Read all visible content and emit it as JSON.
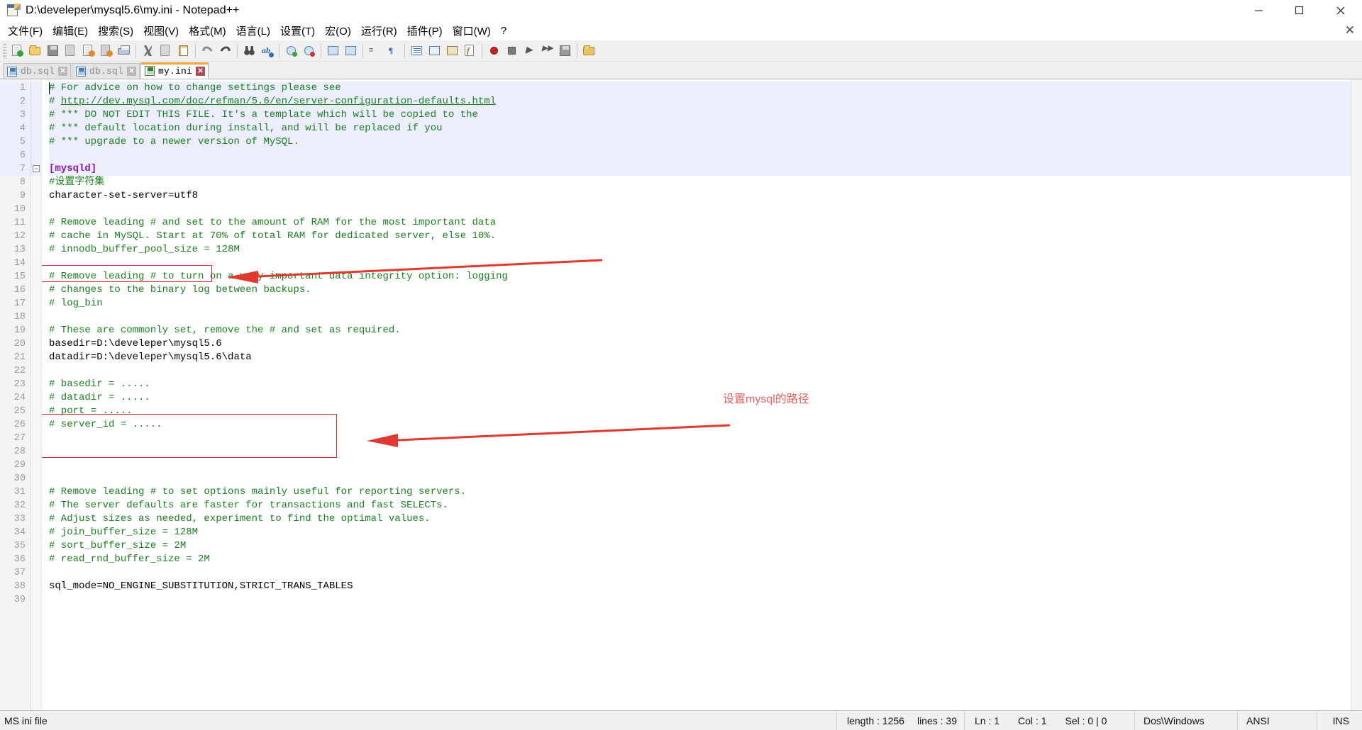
{
  "window": {
    "title": "D:\\develeper\\mysql5.6\\my.ini - Notepad++",
    "icon": "notepad-plus-plus-icon",
    "minimize_label": "–",
    "maximize_label": "❐",
    "close_label": "✕"
  },
  "menu": {
    "items": [
      {
        "label": "文件(F)",
        "name": "menu-file"
      },
      {
        "label": "编辑(E)",
        "name": "menu-edit"
      },
      {
        "label": "搜索(S)",
        "name": "menu-search"
      },
      {
        "label": "视图(V)",
        "name": "menu-view"
      },
      {
        "label": "格式(M)",
        "name": "menu-format"
      },
      {
        "label": "语言(L)",
        "name": "menu-language"
      },
      {
        "label": "设置(T)",
        "name": "menu-settings"
      },
      {
        "label": "宏(O)",
        "name": "menu-macro"
      },
      {
        "label": "运行(R)",
        "name": "menu-run"
      },
      {
        "label": "插件(P)",
        "name": "menu-plugins"
      },
      {
        "label": "窗口(W)",
        "name": "menu-window"
      },
      {
        "label": "?",
        "name": "menu-help"
      }
    ],
    "close_doc_label": "✕"
  },
  "toolbar": {
    "buttons": [
      "new-file-icon",
      "open-file-icon",
      "save-icon",
      "save-all-icon",
      "close-file-icon",
      "close-all-icon",
      "print-icon",
      "cut-icon",
      "copy-icon",
      "paste-icon",
      "undo-icon",
      "redo-icon",
      "find-icon",
      "replace-icon",
      "zoom-in-icon",
      "zoom-out-icon",
      "sync-v-scroll-icon",
      "sync-h-scroll-icon",
      "word-wrap-icon",
      "show-all-chars-icon",
      "indent-guide-icon",
      "ui-ab-icon",
      "user-define-dialog-icon",
      "doc-map-icon",
      "record-macro-icon",
      "stop-macro-icon",
      "play-macro-icon",
      "fast-playback-icon",
      "save-macro-icon",
      "run-icon"
    ]
  },
  "tabs": [
    {
      "label": "db.sql",
      "active": false,
      "icon": "saved-file-icon",
      "close": "✕"
    },
    {
      "label": "db.sql",
      "active": false,
      "icon": "saved-file-icon",
      "close": "✕"
    },
    {
      "label": "my.ini",
      "active": true,
      "icon": "saved-file-icon",
      "close": "✕"
    }
  ],
  "editor": {
    "lines": [
      {
        "n": 1,
        "type": "comment",
        "text": "# For advice on how to change settings please see",
        "highlight": true
      },
      {
        "n": 2,
        "type": "link",
        "prefix": "# ",
        "text": "http://dev.mysql.com/doc/refman/5.6/en/server-configuration-defaults.html",
        "highlight": true
      },
      {
        "n": 3,
        "type": "comment",
        "text": "# *** DO NOT EDIT THIS FILE. It's a template which will be copied to the",
        "highlight": true
      },
      {
        "n": 4,
        "type": "comment",
        "text": "# *** default location during install, and will be replaced if you",
        "highlight": true
      },
      {
        "n": 5,
        "type": "comment",
        "text": "# *** upgrade to a newer version of MySQL.",
        "highlight": true
      },
      {
        "n": 6,
        "type": "blank",
        "text": "",
        "highlight": true
      },
      {
        "n": 7,
        "type": "section",
        "text": "[mysqld]",
        "highlight": true,
        "fold": true
      },
      {
        "n": 8,
        "type": "comment",
        "text": "#设置字符集",
        "highlight": false
      },
      {
        "n": 9,
        "type": "code",
        "text": "character-set-server=utf8",
        "highlight": false
      },
      {
        "n": 10,
        "type": "blank",
        "text": "",
        "highlight": false
      },
      {
        "n": 11,
        "type": "comment",
        "text": "# Remove leading # and set to the amount of RAM for the most important data",
        "highlight": false
      },
      {
        "n": 12,
        "type": "comment",
        "text": "# cache in MySQL. Start at 70% of total RAM for dedicated server, else 10%.",
        "highlight": false
      },
      {
        "n": 13,
        "type": "comment",
        "text": "# innodb_buffer_pool_size = 128M",
        "highlight": false
      },
      {
        "n": 14,
        "type": "blank",
        "text": "",
        "highlight": false
      },
      {
        "n": 15,
        "type": "comment",
        "text": "# Remove leading # to turn on a very important data integrity option: logging",
        "highlight": false
      },
      {
        "n": 16,
        "type": "comment",
        "text": "# changes to the binary log between backups.",
        "highlight": false
      },
      {
        "n": 17,
        "type": "comment",
        "text": "# log_bin",
        "highlight": false
      },
      {
        "n": 18,
        "type": "blank",
        "text": "",
        "highlight": false
      },
      {
        "n": 19,
        "type": "comment",
        "text": "# These are commonly set, remove the # and set as required.",
        "highlight": false
      },
      {
        "n": 20,
        "type": "code",
        "text": "basedir=D:\\develeper\\mysql5.6",
        "highlight": false
      },
      {
        "n": 21,
        "type": "code",
        "text": "datadir=D:\\develeper\\mysql5.6\\data",
        "highlight": false
      },
      {
        "n": 22,
        "type": "blank",
        "text": "",
        "highlight": false
      },
      {
        "n": 23,
        "type": "comment",
        "text": "# basedir = .....",
        "highlight": false
      },
      {
        "n": 24,
        "type": "comment",
        "text": "# datadir = .....",
        "highlight": false
      },
      {
        "n": 25,
        "type": "comment",
        "text": "# port = .....",
        "highlight": false
      },
      {
        "n": 26,
        "type": "comment",
        "text": "# server_id = .....",
        "highlight": false
      },
      {
        "n": 27,
        "type": "blank",
        "text": "",
        "highlight": false
      },
      {
        "n": 28,
        "type": "blank",
        "text": "",
        "highlight": false
      },
      {
        "n": 29,
        "type": "blank",
        "text": "",
        "highlight": false
      },
      {
        "n": 30,
        "type": "blank",
        "text": "",
        "highlight": false
      },
      {
        "n": 31,
        "type": "comment",
        "text": "# Remove leading # to set options mainly useful for reporting servers.",
        "highlight": false
      },
      {
        "n": 32,
        "type": "comment",
        "text": "# The server defaults are faster for transactions and fast SELECTs.",
        "highlight": false
      },
      {
        "n": 33,
        "type": "comment",
        "text": "# Adjust sizes as needed, experiment to find the optimal values.",
        "highlight": false
      },
      {
        "n": 34,
        "type": "comment",
        "text": "# join_buffer_size = 128M",
        "highlight": false
      },
      {
        "n": 35,
        "type": "comment",
        "text": "# sort_buffer_size = 2M",
        "highlight": false
      },
      {
        "n": 36,
        "type": "comment",
        "text": "# read_rnd_buffer_size = 2M",
        "highlight": false
      },
      {
        "n": 37,
        "type": "blank",
        "text": "",
        "highlight": false
      },
      {
        "n": 38,
        "type": "code",
        "text": "sql_mode=NO_ENGINE_SUBSTITUTION,STRICT_TRANS_TABLES",
        "highlight": false
      },
      {
        "n": 39,
        "type": "blank",
        "text": "",
        "highlight": false
      }
    ]
  },
  "annotations": {
    "charset_note": "",
    "path_note": "设置mysql的路径"
  },
  "statusbar": {
    "file_type": "MS ini file",
    "length_label": "length : 1256",
    "lines_label": "lines : 39",
    "ln": "Ln : 1",
    "col": "Col : 1",
    "sel": "Sel : 0 | 0",
    "eol": "Dos\\Windows",
    "encoding": "ANSI",
    "insert_mode": "INS"
  },
  "colors": {
    "accent_tab": "#f2a33c",
    "comment_green": "#1a8020",
    "section_purple": "#8a14b8",
    "annotation_red": "#e8615e",
    "box_red": "#d0322f",
    "highlight_bg": "#eceefb"
  }
}
